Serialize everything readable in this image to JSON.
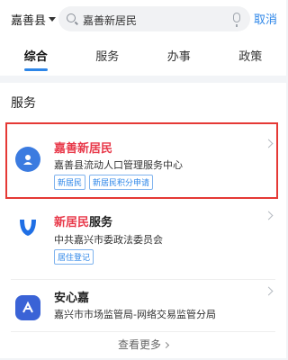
{
  "header": {
    "region": "嘉善县",
    "search_value": "嘉善新居民",
    "cancel": "取消"
  },
  "tabs": [
    {
      "label": "综合",
      "active": true
    },
    {
      "label": "服务",
      "active": false
    },
    {
      "label": "办事",
      "active": false
    },
    {
      "label": "政策",
      "active": false
    }
  ],
  "section_title": "服务",
  "results": [
    {
      "name_highlight": "嘉善新居民",
      "name_rest": "",
      "org": "嘉善县流动人口管理服务中心",
      "tags": [
        "新居民",
        "新居民积分申请"
      ],
      "logo_color": "#3b7be0"
    },
    {
      "name_highlight": "新居民",
      "name_rest": "服务",
      "org": "中共嘉兴市委政法委员会",
      "tags": [
        "居住登记"
      ],
      "logo_color": "#1f6fe5"
    },
    {
      "name_highlight": "",
      "name_rest": "安心嘉",
      "org": "嘉兴市市场监管局-网络交易监管分局",
      "tags": [],
      "logo_color": "#3a63d6"
    }
  ],
  "more": "查看更多"
}
